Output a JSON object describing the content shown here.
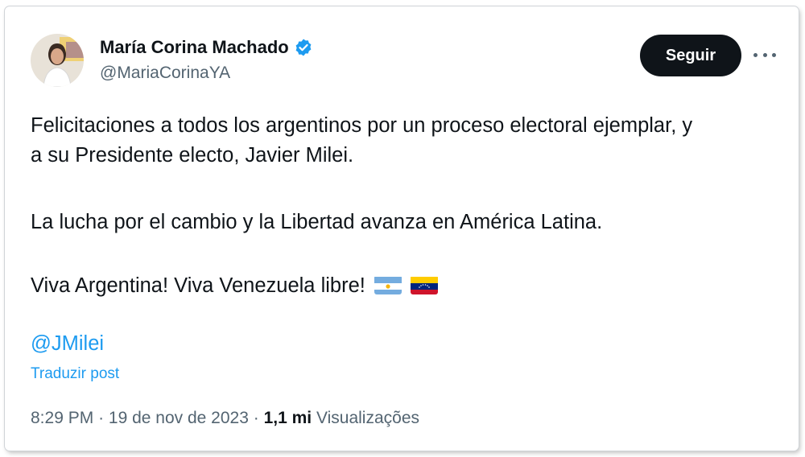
{
  "author": {
    "name": "María Corina Machado",
    "handle": "@MariaCorinaYA",
    "avatar_icon": "profile-photo",
    "verified_icon": "verified-badge-icon"
  },
  "actions": {
    "follow_label": "Seguir",
    "more_icon": "more-options-icon"
  },
  "tweet": {
    "line1": "Felicitaciones a todos los argentinos por un proceso electoral ejemplar, y",
    "line2": "a su Presidente electo, Javier Milei.",
    "line3": "La lucha por el cambio y la Libertad avanza en América Latina.",
    "line4": "Viva Argentina! Viva Venezuela libre!",
    "flags": [
      "argentina-flag-emoji",
      "venezuela-flag-emoji"
    ],
    "mention": "@JMilei",
    "translate_label": "Traduzir post"
  },
  "meta": {
    "time": "8:29 PM",
    "date": "19 de nov de 2023",
    "separator": "·",
    "views_count": "1,1 mi",
    "views_label": "Visualizações"
  },
  "colors": {
    "link": "#1d9bf0",
    "secondary_text": "#536471",
    "follow_bg": "#0f1419"
  }
}
